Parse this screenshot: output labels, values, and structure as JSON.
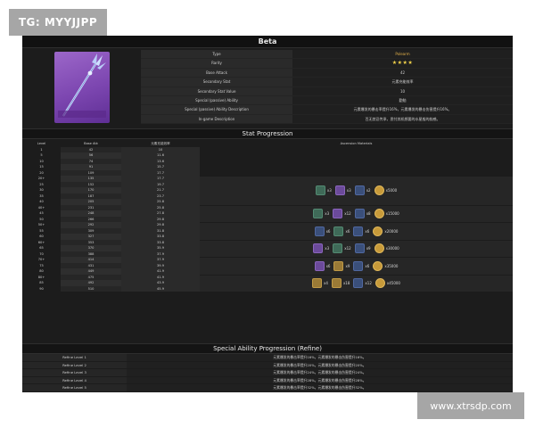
{
  "watermark_top": "TG: MYYJJPP",
  "watermark_bottom": "www.xtrsdp.com",
  "title": "Beta",
  "info": [
    {
      "key": "Type",
      "value": "Polearm"
    },
    {
      "key": "Rarity",
      "value": "★★★★"
    },
    {
      "key": "Base Attack",
      "value": "42"
    },
    {
      "key": "Secondary Stat",
      "value": "元素充能效率"
    },
    {
      "key": "Secondary Stat Value",
      "value": "10"
    },
    {
      "key": "Special (passive) Ability",
      "value": "勤勉"
    },
    {
      "key": "Special (passive) Ability Description",
      "value": "元素爆发的暴击率提升16%，元素爆发的暴击伤害提升16%。"
    },
    {
      "key": "In-game Description",
      "value": "百无禁忌传承，思忖其机想要的水星般的韵感。"
    }
  ],
  "stat_progression": {
    "heading": "Stat Progression",
    "columns": [
      "Level",
      "Base Atk",
      "元素充能效率",
      "Ascension Materials"
    ],
    "rows": [
      [
        "1",
        "42",
        "10"
      ],
      [
        "5",
        "56",
        "11.6"
      ],
      [
        "10",
        "74",
        "13.6"
      ],
      [
        "15",
        "91",
        "15.7"
      ],
      [
        "20",
        "109",
        "17.7"
      ],
      [
        "20+",
        "135",
        "17.7"
      ],
      [
        "25",
        "152",
        "19.7"
      ],
      [
        "30",
        "170",
        "21.7"
      ],
      [
        "35",
        "187",
        "23.7"
      ],
      [
        "40",
        "205",
        "25.8"
      ],
      [
        "40+",
        "231",
        "25.8"
      ],
      [
        "45",
        "248",
        "27.8"
      ],
      [
        "50",
        "266",
        "29.8"
      ],
      [
        "50+",
        "292",
        "29.8"
      ],
      [
        "55",
        "309",
        "31.8"
      ],
      [
        "60",
        "327",
        "33.8"
      ],
      [
        "60+",
        "353",
        "33.8"
      ],
      [
        "65",
        "370",
        "35.9"
      ],
      [
        "70",
        "388",
        "37.9"
      ],
      [
        "70+",
        "414",
        "37.9"
      ],
      [
        "75",
        "431",
        "39.9"
      ],
      [
        "80",
        "449",
        "41.9"
      ],
      [
        "80+",
        "475",
        "41.9"
      ],
      [
        "85",
        "492",
        "43.9"
      ],
      [
        "90",
        "510",
        "45.9"
      ]
    ]
  },
  "ascension_materials": [
    {
      "items": [
        {
          "icon": "green-gem-icon",
          "qty": "x3"
        },
        {
          "icon": "purple-mask-icon",
          "qty": "x3"
        },
        {
          "icon": "blue-fragment-icon",
          "qty": "x2"
        }
      ],
      "mora": "x5000"
    },
    {
      "items": [
        {
          "icon": "green-gem-icon",
          "qty": "x3"
        },
        {
          "icon": "purple-mask-icon",
          "qty": "x12"
        },
        {
          "icon": "blue-fragment-icon",
          "qty": "x8"
        }
      ],
      "mora": "x15000"
    },
    {
      "items": [
        {
          "icon": "blue-gem-icon",
          "qty": "x6"
        },
        {
          "icon": "green-mask-icon",
          "qty": "x6"
        },
        {
          "icon": "blue-fragment-icon",
          "qty": "x6"
        }
      ],
      "mora": "x20000"
    },
    {
      "items": [
        {
          "icon": "purple-gem-icon",
          "qty": "x3"
        },
        {
          "icon": "green-mask-icon",
          "qty": "x12"
        },
        {
          "icon": "blue-fragment-icon",
          "qty": "x9"
        }
      ],
      "mora": "x30000"
    },
    {
      "items": [
        {
          "icon": "purple-gem-icon",
          "qty": "x6"
        },
        {
          "icon": "orange-mask-icon",
          "qty": "x9"
        },
        {
          "icon": "blue-fragment-icon",
          "qty": "x6"
        }
      ],
      "mora": "x35000"
    },
    {
      "items": [
        {
          "icon": "orange-gem-icon",
          "qty": "x4"
        },
        {
          "icon": "orange-mask-icon",
          "qty": "x18"
        },
        {
          "icon": "blue-fragment-icon",
          "qty": "x12"
        }
      ],
      "mora": "x45000"
    }
  ],
  "refine": {
    "heading": "Special Ability Progression (Refine)",
    "rows": [
      {
        "level": "Refine Level 1",
        "text": "元素爆发的暴击率提升16%，元素爆发的暴击伤害提升16%。"
      },
      {
        "level": "Refine Level 2",
        "text": "元素爆发的暴击率提升20%，元素爆发的暴击伤害提升20%。"
      },
      {
        "level": "Refine Level 3",
        "text": "元素爆发的暴击率提升24%，元素爆发的暴击伤害提升24%。"
      },
      {
        "level": "Refine Level 4",
        "text": "元素爆发的暴击率提升28%，元素爆发的暴击伤害提升28%。"
      },
      {
        "level": "Refine Level 5",
        "text": "元素爆发的暴击率提升32%，元素爆发的暴击伤害提升32%。"
      }
    ]
  }
}
